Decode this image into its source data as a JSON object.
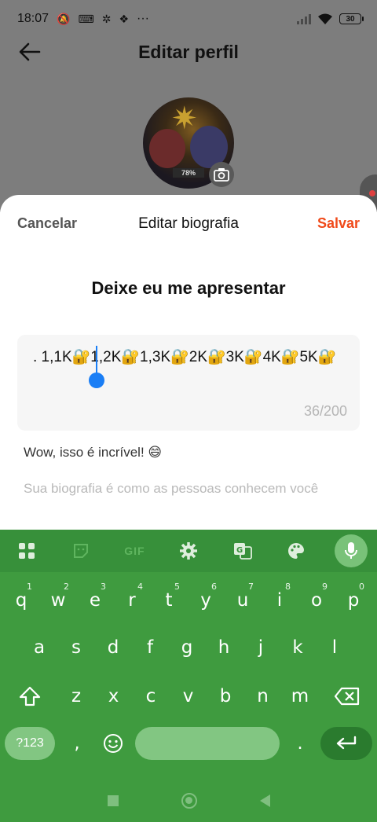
{
  "status_bar": {
    "time": "18:07",
    "battery": "30",
    "more": "···"
  },
  "header": {
    "title": "Editar perfil"
  },
  "avatar": {
    "progress_label": "78%"
  },
  "sheet": {
    "cancel_label": "Cancelar",
    "title": "Editar biografia",
    "save_label": "Salvar",
    "intro_title": "Deixe eu me apresentar",
    "bio_value": ". 1,1K🔐1,2K🔐1,3K🔐2K🔐3K🔐4K🔐5K🔐",
    "counter": "36/200",
    "suggestion": "Wow, isso é incrível! 😄",
    "hint": "Sua biografia é como as pessoas conhecem você"
  },
  "keyboard": {
    "toolbar": [
      "apps-grid-icon",
      "sticker-icon",
      "GIF",
      "settings-gear-icon",
      "translate-icon",
      "palette-icon",
      "mic-icon"
    ],
    "row1": [
      "q",
      "w",
      "e",
      "r",
      "t",
      "y",
      "u",
      "i",
      "o",
      "p"
    ],
    "row1_numbers": [
      "1",
      "2",
      "3",
      "4",
      "5",
      "6",
      "7",
      "8",
      "9",
      "0"
    ],
    "row2": [
      "a",
      "s",
      "d",
      "f",
      "g",
      "h",
      "j",
      "k",
      "l"
    ],
    "row3": [
      "z",
      "x",
      "c",
      "v",
      "b",
      "n",
      "m"
    ],
    "symbols_label": "?123",
    "comma": ",",
    "period": ".",
    "accent_color": "#3f9b3f"
  },
  "colors": {
    "save": "#f04a1a",
    "cursor": "#1a7ef5",
    "keyboard_bg": "#3f9b3f"
  }
}
